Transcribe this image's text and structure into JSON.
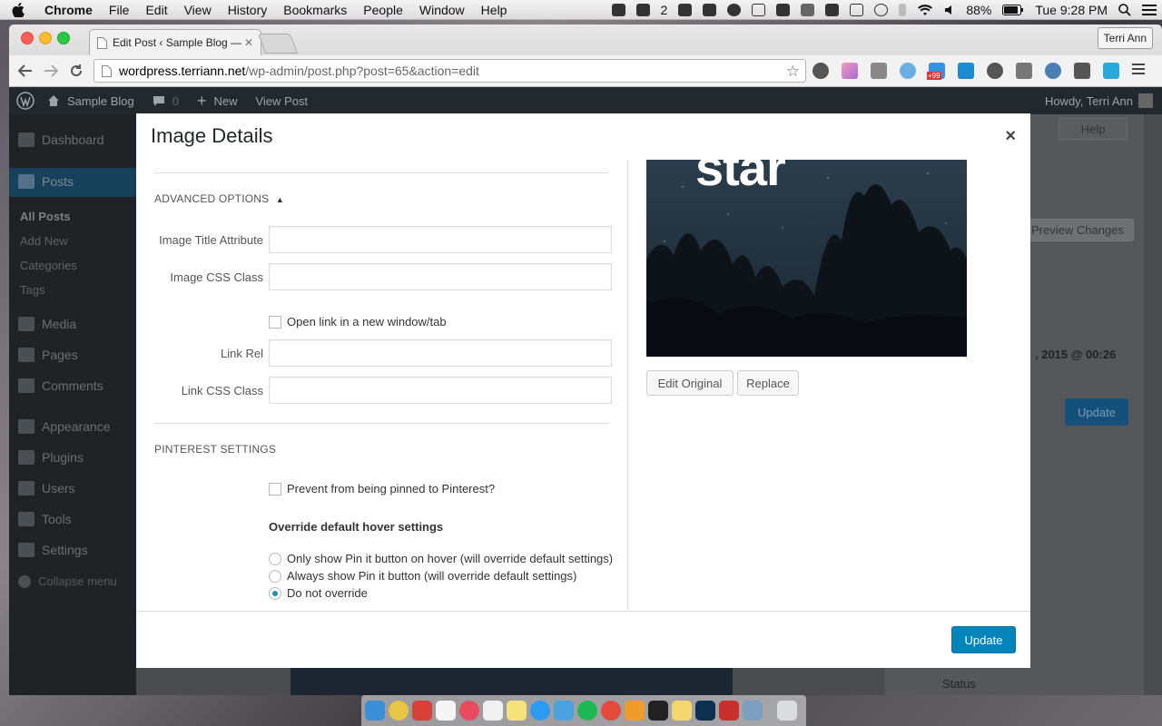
{
  "menubar": {
    "app": "Chrome",
    "items": [
      "File",
      "Edit",
      "View",
      "History",
      "Bookmarks",
      "People",
      "Window",
      "Help"
    ],
    "badge_count": "2",
    "battery": "88%",
    "clock": "Tue 9:28 PM"
  },
  "browser": {
    "tab_title": "Edit Post ‹ Sample Blog —",
    "profile": "Terri Ann",
    "url_host": "wordpress.terriann.net",
    "url_path": "/wp-admin/post.php?post=65&action=edit",
    "ext_badge": "+99"
  },
  "adminbar": {
    "site": "Sample Blog",
    "comments_count": "0",
    "new": "New",
    "view_post": "View Post",
    "howdy": "Howdy, Terri Ann"
  },
  "sidebar": {
    "dashboard": "Dashboard",
    "posts": "Posts",
    "posts_sub": [
      "All Posts",
      "Add New",
      "Categories",
      "Tags"
    ],
    "media": "Media",
    "pages": "Pages",
    "comments": "Comments",
    "appearance": "Appearance",
    "plugins": "Plugins",
    "users": "Users",
    "tools": "Tools",
    "settings": "Settings",
    "collapse": "Collapse menu"
  },
  "background": {
    "help": "Help",
    "preview_changes": "Preview Changes",
    "date_fragment": ", 2015 @ 00:26",
    "update": "Update",
    "status": "Status"
  },
  "modal": {
    "title": "Image Details",
    "close": "×",
    "advanced_heading": "ADVANCED OPTIONS",
    "image_title_attr": {
      "label": "Image Title Attribute",
      "value": ""
    },
    "image_css_class": {
      "label": "Image CSS Class",
      "value": ""
    },
    "open_new_window": {
      "label": "Open link in a new window/tab",
      "checked": false
    },
    "link_rel": {
      "label": "Link Rel",
      "value": ""
    },
    "link_css_class": {
      "label": "Link CSS Class",
      "value": ""
    },
    "pinterest_heading": "PINTEREST SETTINGS",
    "prevent_pin": {
      "label": "Prevent from being pinned to Pinterest?",
      "checked": false
    },
    "hover_heading": "Override default hover settings",
    "hover_options": [
      {
        "label": "Only show Pin it button on hover (will override default settings)",
        "selected": false
      },
      {
        "label": "Always show Pin it button (will override default settings)",
        "selected": false
      },
      {
        "label": "Do not override",
        "selected": true
      }
    ],
    "image_text": "star",
    "edit_original": "Edit Original",
    "replace": "Replace",
    "update": "Update"
  }
}
